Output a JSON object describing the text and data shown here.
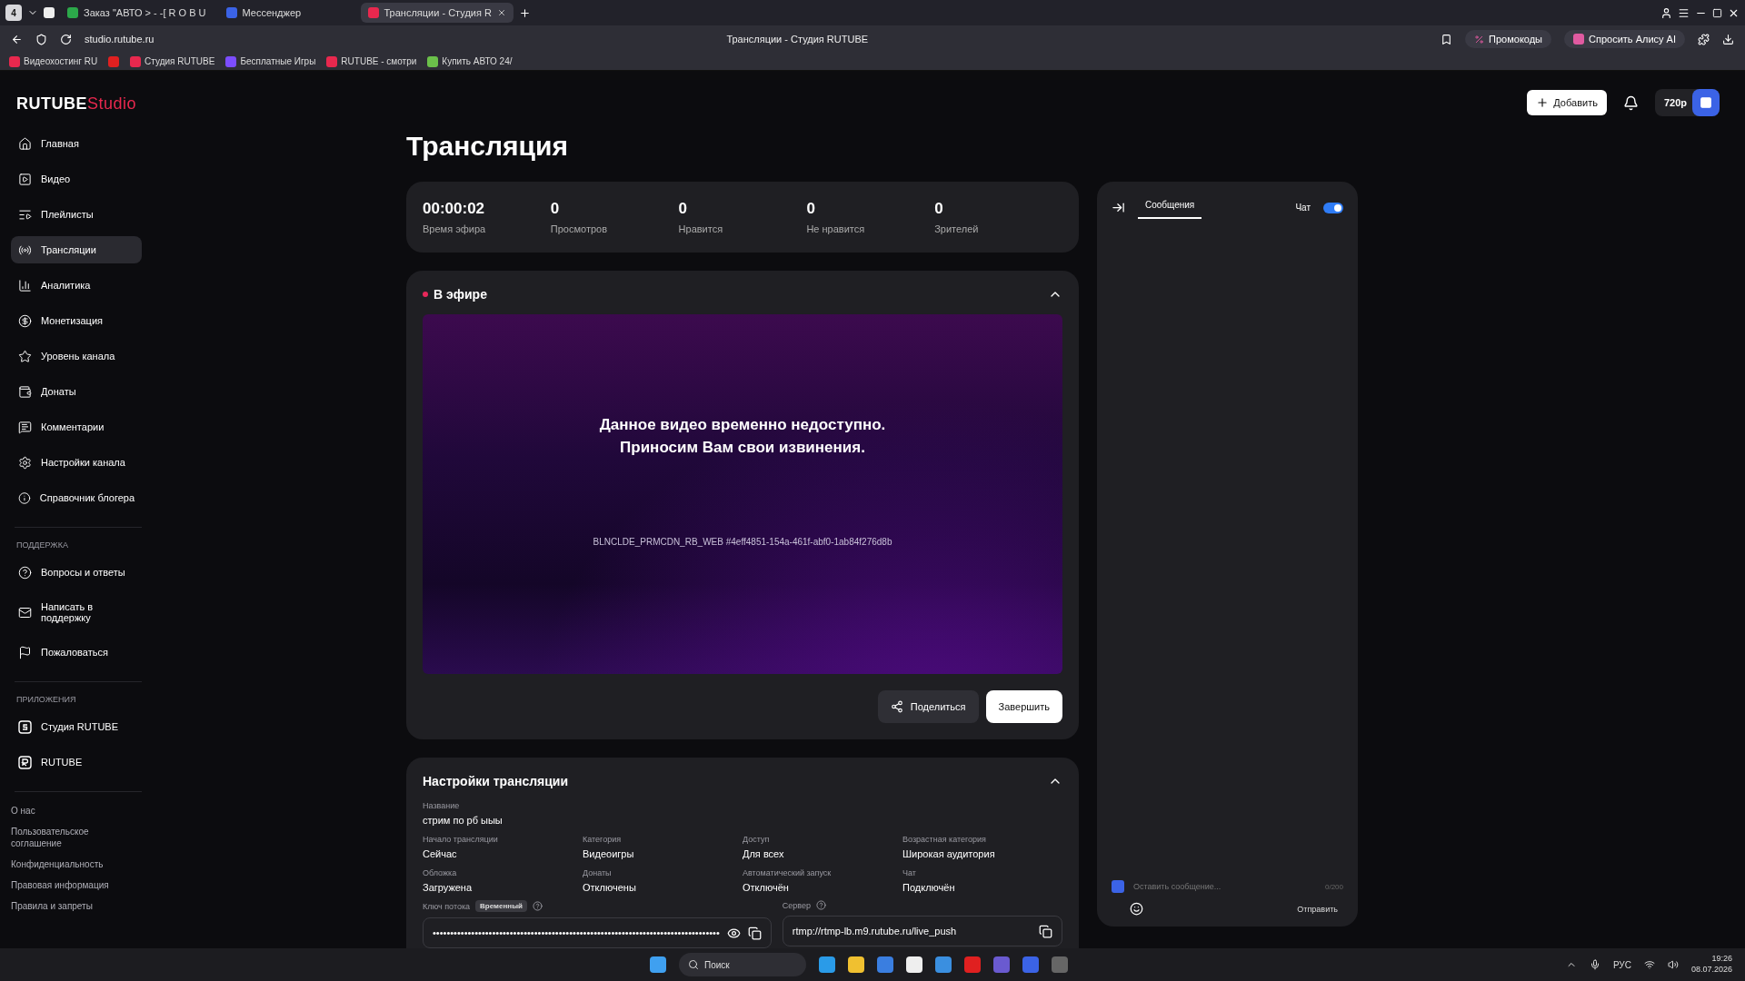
{
  "browser": {
    "tab_count": "4",
    "tabs": [
      {
        "title": "Заказ \"АВТО > - -[ R O B U",
        "selected": false
      },
      {
        "title": "Мессенджер",
        "selected": false
      },
      {
        "title": "Трансляции - Студия R",
        "selected": true
      }
    ],
    "address": "studio.rutube.ru",
    "page_title": "Трансляции - Студия RUTUBE",
    "promo": "Промокоды",
    "alice": "Спросить Алису AI",
    "bookmarks": [
      "Видеохостинг RU",
      "Студия RUTUBE",
      "Бесплатные Игры",
      "RUTUBE - смотри",
      "Купить АВТО 24/"
    ]
  },
  "logo": {
    "brand": "RUTUBE",
    "product": "Studio"
  },
  "header": {
    "add": "Добавить",
    "quality": "720p"
  },
  "nav": [
    {
      "label": "Главная",
      "selected": false
    },
    {
      "label": "Видео",
      "selected": false
    },
    {
      "label": "Плейлисты",
      "selected": false
    },
    {
      "label": "Трансляции",
      "selected": true
    },
    {
      "label": "Аналитика",
      "selected": false
    },
    {
      "label": "Монетизация",
      "selected": false
    },
    {
      "label": "Уровень канала",
      "selected": false
    },
    {
      "label": "Донаты",
      "selected": false
    },
    {
      "label": "Комментарии",
      "selected": false
    },
    {
      "label": "Настройки канала",
      "selected": false
    },
    {
      "label": "Справочник блогера",
      "selected": false
    }
  ],
  "support": {
    "heading": "ПОДДЕРЖКА",
    "items": [
      "Вопросы и ответы",
      "Написать в поддержку",
      "Пожаловаться"
    ]
  },
  "apps": {
    "heading": "ПРИЛОЖЕНИЯ",
    "items": [
      "Студия RUTUBE",
      "RUTUBE"
    ]
  },
  "footer_links": [
    "О нас",
    "Пользовательское соглашение",
    "Конфиденциальность",
    "Правовая информация",
    "Правила и запреты"
  ],
  "page_title": "Трансляция",
  "stats": [
    {
      "value": "00:00:02",
      "label": "Время эфира"
    },
    {
      "value": "0",
      "label": "Просмотров"
    },
    {
      "value": "0",
      "label": "Нравится"
    },
    {
      "value": "0",
      "label": "Не нравится"
    },
    {
      "value": "0",
      "label": "Зрителей"
    }
  ],
  "live": {
    "title": "В эфире",
    "expanded": true,
    "message": [
      "Данное видео временно недоступно.",
      "Приносим Вам свои извинения."
    ],
    "error_code": "BLNCLDE_PRMCDN_RB_WEB #4eff4851-154a-461f-abf0-1ab84f276d8b",
    "share": "Поделиться",
    "finish": "Завершить"
  },
  "settings": {
    "title": "Настройки трансляции",
    "expanded": true,
    "name_label": "Название",
    "name_value": "стрим по рб ыыы",
    "fields": [
      {
        "label": "Начало трансляции",
        "value": "Сейчас"
      },
      {
        "label": "Категория",
        "value": "Видеоигры"
      },
      {
        "label": "Доступ",
        "value": "Для всех"
      },
      {
        "label": "Возрастная категория",
        "value": "Широкая аудитория"
      },
      {
        "label": "Обложка",
        "value": "Загружена"
      },
      {
        "label": "Донаты",
        "value": "Отключены"
      },
      {
        "label": "Автоматический запуск",
        "value": "Отключён"
      },
      {
        "label": "Чат",
        "value": "Подключён"
      }
    ],
    "key_label": "Ключ потока",
    "key_badge": "Временный",
    "key_value": "••••••••••••••••••••••••••••••••••••••••••••••••••••••••••••••••••••••••••••••••••",
    "server_label": "Сервер",
    "server_value": "rtmp://rtmp-lb.m9.rutube.ru/live_push"
  },
  "chat": {
    "tab": "Сообщения",
    "toggle_label": "Чат",
    "on": true,
    "placeholder": "Оставить сообщение...",
    "counter": "0/200",
    "send": "Отправить"
  },
  "taskbar": {
    "search": "Поиск",
    "lang": "РУС",
    "time": "19:26",
    "date": "08.07.2026"
  }
}
